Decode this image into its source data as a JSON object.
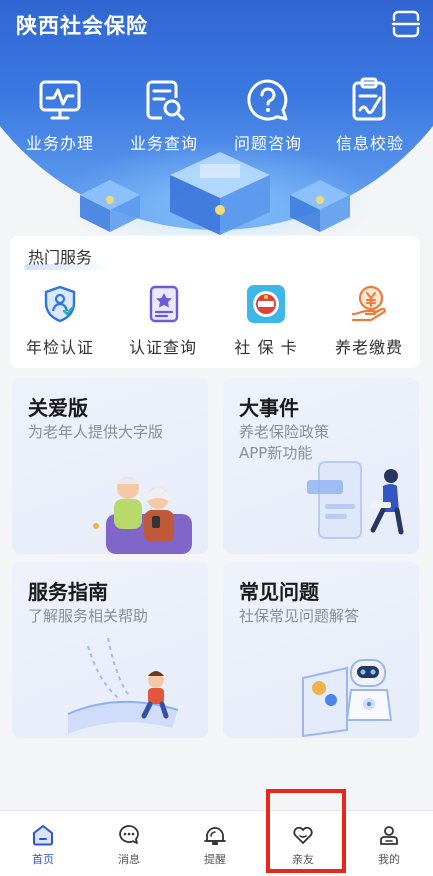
{
  "header": {
    "title": "陕西社会保险",
    "scan_icon": "scan-icon"
  },
  "quick_actions": [
    {
      "label": "业务办理",
      "icon": "monitor-chart-icon"
    },
    {
      "label": "业务查询",
      "icon": "document-search-icon"
    },
    {
      "label": "问题咨询",
      "icon": "question-bubble-icon"
    },
    {
      "label": "信息校验",
      "icon": "clipboard-sign-icon"
    }
  ],
  "hot_services": {
    "title": "热门服务",
    "items": [
      {
        "label": "年检认证",
        "icon": "shield-person-icon"
      },
      {
        "label": "认证查询",
        "icon": "star-card-icon"
      },
      {
        "label": "社 保 卡",
        "icon": "social-security-card-icon"
      },
      {
        "label": "养老缴费",
        "icon": "yuan-hand-icon"
      }
    ]
  },
  "cards": [
    {
      "title": "关爱版",
      "subtitle": "为老年人提供大字版"
    },
    {
      "title": "大事件",
      "subtitle": "养老保险政策\nAPP新功能"
    },
    {
      "title": "服务指南",
      "subtitle": "了解服务相关帮助"
    },
    {
      "title": "常见问题",
      "subtitle": "社保常见问题解答"
    }
  ],
  "bottom_nav": [
    {
      "label": "首页",
      "icon": "home-icon",
      "active": true
    },
    {
      "label": "消息",
      "icon": "chat-bubble-icon",
      "active": false
    },
    {
      "label": "提醒",
      "icon": "bell-icon",
      "active": false
    },
    {
      "label": "亲友",
      "icon": "heart-icon",
      "active": false
    },
    {
      "label": "我的",
      "icon": "user-icon",
      "active": false
    }
  ],
  "colors": {
    "primary": "#2a57c9",
    "header_dark": "#1c3aa6",
    "highlight": "#e8261b"
  }
}
